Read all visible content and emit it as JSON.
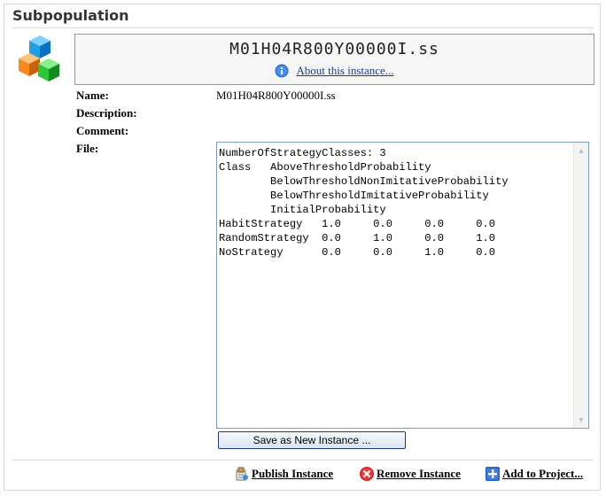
{
  "panel": {
    "title": "Subpopulation"
  },
  "header": {
    "instance_name": "M01H04R800Y00000I.ss",
    "about_link": "About this instance..."
  },
  "fields": {
    "name_label": "Name:",
    "name_value": "M01H04R800Y00000I.ss",
    "description_label": "Description:",
    "comment_label": "Comment:",
    "file_label": "File:"
  },
  "file": {
    "content": "NumberOfStrategyClasses: 3\nClass   AboveThresholdProbability\n        BelowThresholdNonImitativeProbability\n        BelowThresholdImitativeProbability\n        InitialProbability\nHabitStrategy   1.0     0.0     0.0     0.0\nRandomStrategy  0.0     1.0     0.0     1.0\nNoStrategy      0.0     0.0     1.0     0.0"
  },
  "buttons": {
    "save_label": "Save as New Instance ..."
  },
  "actions": {
    "publish_label": "Publish Instance",
    "remove_label": "Remove Instance",
    "add_label": "Add to Project..."
  },
  "icons": {
    "logo": "cubes-logo-icon",
    "about": "info-icon",
    "publish": "publish-icon",
    "remove": "remove-icon",
    "add": "add-icon"
  },
  "colors": {
    "link": "#1a3d8f",
    "field_border": "#7f9db9",
    "button_border": "#1f3a7a"
  }
}
